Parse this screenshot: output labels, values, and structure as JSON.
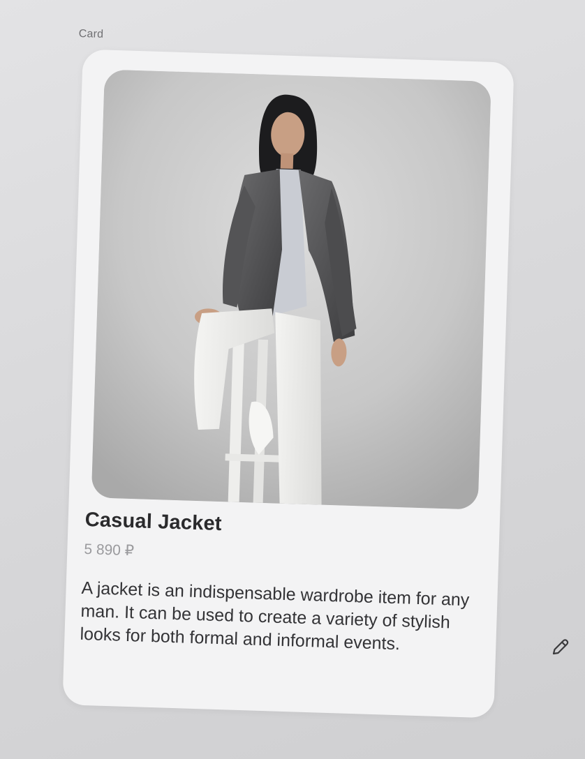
{
  "frame": {
    "label": "Card"
  },
  "card": {
    "image": {
      "icon": "fashion-photo-woman-in-blazer"
    },
    "title": "Casual Jacket",
    "price": "5 890 ₽",
    "description": "A jacket is an indispensable wardrobe item for any man. It can be used to create a variety of stylish looks for both formal and informal events."
  },
  "toolbar": {
    "edit_icon": "pencil-icon"
  }
}
